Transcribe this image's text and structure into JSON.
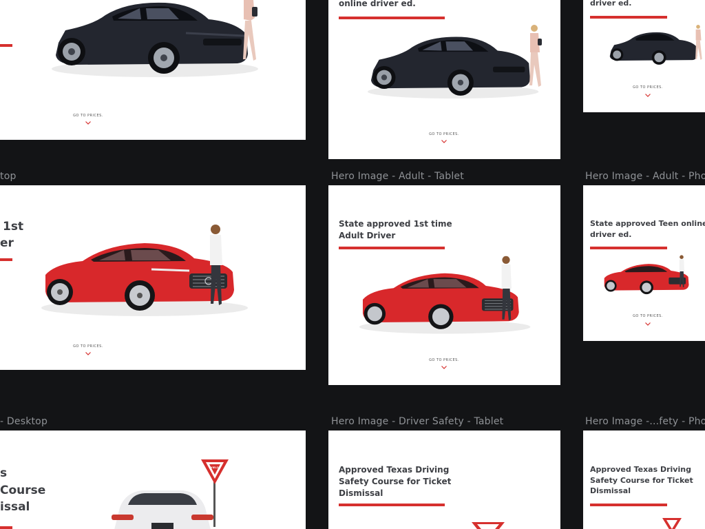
{
  "labels": {
    "desktop_adult": "top",
    "tablet_adult": "Hero Image - Adult - Tablet",
    "phone_adult": "Hero Image - Adult - Phor",
    "desktop_safety": "- Desktop",
    "tablet_safety": "Hero Image - Driver Safety - Tablet",
    "phone_safety": "Hero Image -...fety - Phor"
  },
  "teen": {
    "tablet_heading_line2": "online driver ed.",
    "phone_heading_line2": "driver ed.",
    "cta": "GO TO PRICES."
  },
  "adult": {
    "desktop_heading_line1": "1st",
    "desktop_heading_line2": "er",
    "tablet_heading_line1": "State approved 1st time",
    "tablet_heading_line2": "Adult Driver",
    "phone_heading_line1": "State approved Teen online",
    "phone_heading_line2": "driver ed.",
    "cta": "GO TO PRICES."
  },
  "safety": {
    "desktop_heading_line1": "s",
    "desktop_heading_line2": "Course",
    "desktop_heading_line3": "issal",
    "tablet_heading_line1": "Approved Texas Driving",
    "tablet_heading_line2": "Safety Course for Ticket",
    "tablet_heading_line3": "Dismissal",
    "phone_heading_line1": "Approved Texas Driving",
    "phone_heading_line2": "Safety Course for Ticket",
    "phone_heading_line3": "Dismissal",
    "sign_text": "YIELD"
  },
  "colors": {
    "canvas": "#131416",
    "accent_red": "#d6302e",
    "car_dark": "#23262f",
    "car_red": "#d8282b",
    "heading_text": "#3d3f44",
    "label_text": "#8f9296"
  }
}
